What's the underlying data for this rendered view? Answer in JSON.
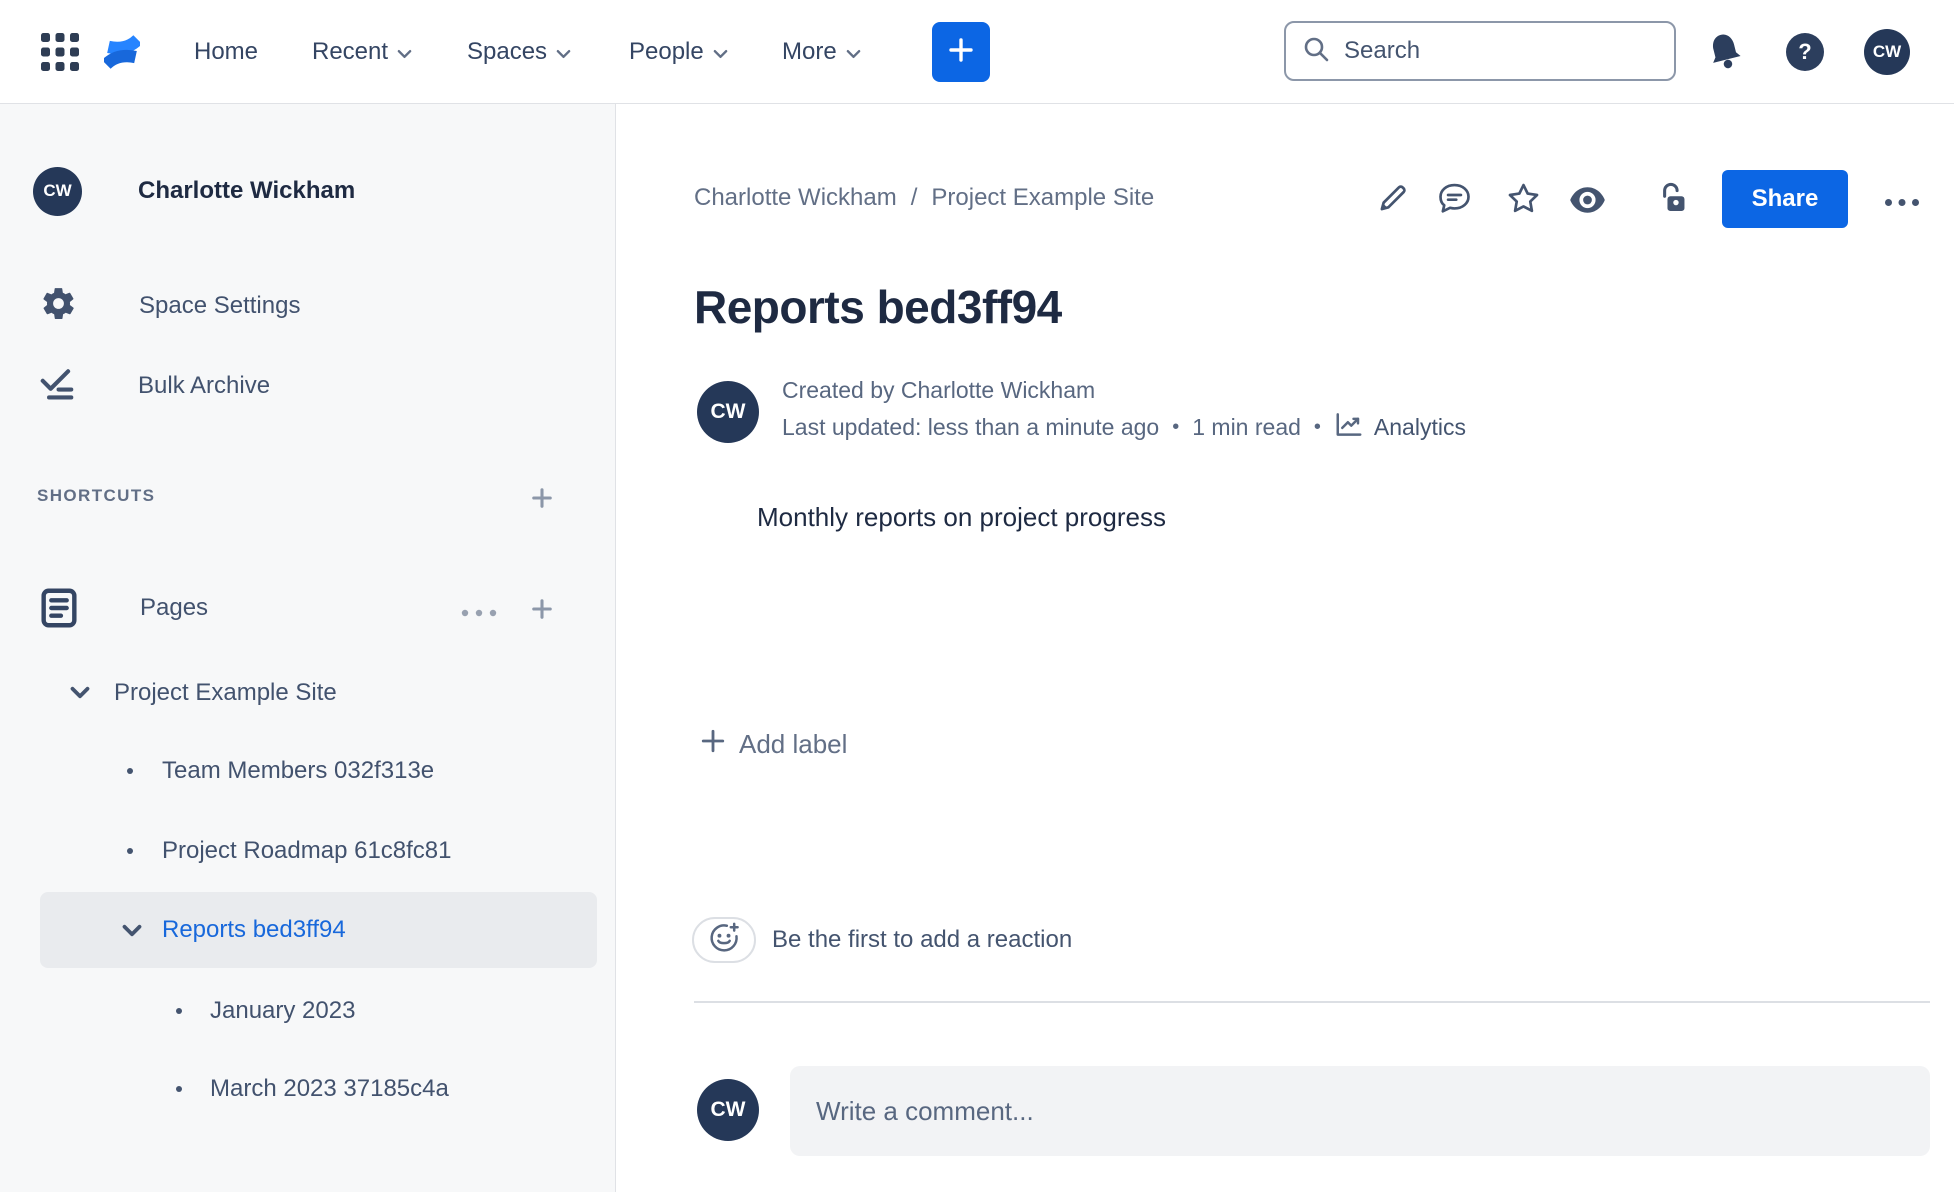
{
  "topbar": {
    "nav": {
      "home": "Home",
      "recent": "Recent",
      "spaces": "Spaces",
      "people": "People",
      "more": "More"
    },
    "search_placeholder": "Search",
    "help_glyph": "?",
    "avatar_initials": "CW"
  },
  "sidebar": {
    "user_name": "Charlotte Wickham",
    "avatar_initials": "CW",
    "space_settings_label": "Space Settings",
    "bulk_archive_label": "Bulk Archive",
    "shortcuts_label": "SHORTCUTS",
    "pages_label": "Pages",
    "tree": {
      "root_label": "Project Example Site",
      "items": [
        "Team Members 032f313e",
        "Project Roadmap 61c8fc81"
      ],
      "selected_label": "Reports bed3ff94",
      "children": [
        "January 2023",
        "March 2023 37185c4a"
      ]
    }
  },
  "content": {
    "breadcrumb": {
      "items": [
        "Charlotte Wickham",
        "Project Example Site"
      ],
      "separator": "/"
    },
    "share_label": "Share",
    "title": "Reports bed3ff94",
    "byline": {
      "created": "Created by Charlotte Wickham",
      "updated": "Last updated: less than a minute ago",
      "separator": "•",
      "read_time": "1 min read",
      "analytics_label": "Analytics",
      "avatar_initials": "CW"
    },
    "body_text": "Monthly reports on project progress",
    "add_label_text": "Add label",
    "reaction_prompt": "Be the first to add a reaction",
    "comment": {
      "placeholder": "Write a comment...",
      "avatar_initials": "CW"
    }
  },
  "colors": {
    "accent": "#0C66E4",
    "link": "#1868DB",
    "avatar_bg": "#253858"
  }
}
